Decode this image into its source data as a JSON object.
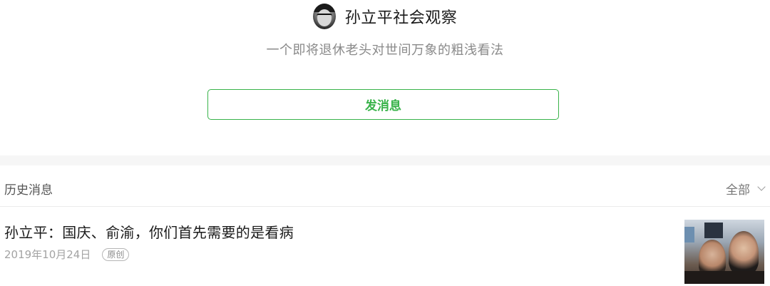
{
  "account": {
    "name": "孙立平社会观察",
    "description": "一个即将退休老头对世间万象的粗浅看法",
    "message_button_label": "发消息"
  },
  "history": {
    "title": "历史消息",
    "filter_label": "全部"
  },
  "articles": [
    {
      "title": "孙立平：国庆、俞渝，你们首先需要的是看病",
      "date": "2019年10月24日",
      "badge": "原创"
    }
  ],
  "colors": {
    "accent": "#39b34a",
    "section_gap": "#f6f6f6"
  },
  "icons": [
    "avatar",
    "chevron-down-icon",
    "article-thumbnail"
  ]
}
